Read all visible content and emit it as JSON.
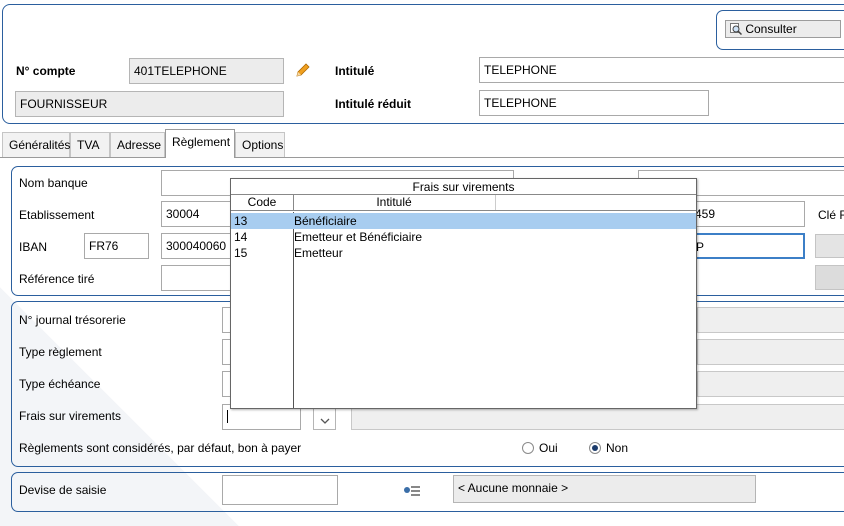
{
  "header": {
    "consulter_label": "Consulter",
    "compte_label": "N° compte",
    "compte_value": "401TELEPHONE",
    "type_value": "FOURNISSEUR",
    "intitule_label": "Intitulé",
    "intitule_value": "TELEPHONE",
    "intitule_reduit_label": "Intitulé réduit",
    "intitule_reduit_value": "TELEPHONE"
  },
  "tabs": [
    "Généralités",
    "TVA",
    "Adresse",
    "Règlement",
    "Options"
  ],
  "active_tab": "Règlement",
  "banque": {
    "nom_banque_label": "Nom banque",
    "etablissement_label": "Etablissement",
    "etablissement_value": "30004",
    "iban_label": "IBAN",
    "iban_country": "FR76",
    "iban_value": "300040060",
    "right_field_1": "459",
    "right_field_2": "P",
    "cle_label": "Clé R",
    "reference_tire_label": "Référence tiré"
  },
  "reglement": {
    "journal_label": "N° journal trésorerie",
    "type_reglement_label": "Type règlement",
    "type_echeance_label": "Type échéance",
    "frais_label": "Frais sur virements",
    "bon_a_payer_label": "Règlements sont considérés, par défaut, bon à payer",
    "oui_label": "Oui",
    "non_label": "Non",
    "bon_a_payer_selected": "Non"
  },
  "devise": {
    "label": "Devise de saisie",
    "monnaie_value": "< Aucune monnaie >"
  },
  "popup": {
    "title": "Frais sur virements",
    "col_code": "Code",
    "col_intitule": "Intitulé",
    "rows": [
      {
        "code": "13",
        "intitule": "Bénéficiaire"
      },
      {
        "code": "14",
        "intitule": "Emetteur et Bénéficiaire"
      },
      {
        "code": "15",
        "intitule": "Emetteur"
      }
    ],
    "selected_index": 0
  },
  "colors": {
    "panel_border": "#2b5f9e",
    "selection": "#a8cdf0",
    "pencil": "#f0a020"
  }
}
